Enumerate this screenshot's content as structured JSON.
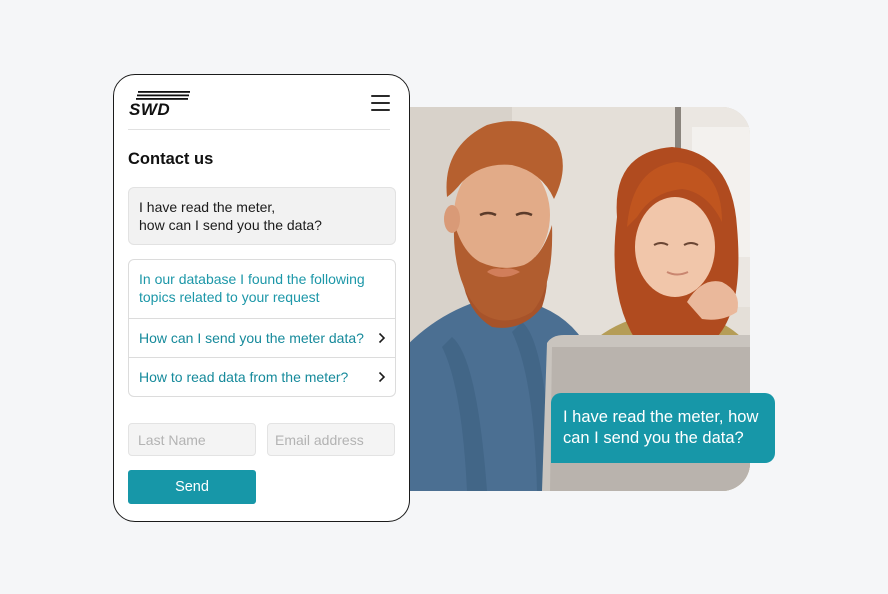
{
  "brand": {
    "logo_text": "SWD",
    "accent": "#1797a8"
  },
  "header": {
    "menu_icon": "hamburger-menu-icon"
  },
  "contact": {
    "title": "Contact us",
    "user_message_line1": "I have read the meter,",
    "user_message_line2": "how can I send you the data?",
    "suggestions_intro_line1": "In our database I found the following",
    "suggestions_intro_line2": "topics related to your request",
    "suggestions": [
      {
        "label": "How can I send you the meter data?",
        "icon": "chevron-right-icon"
      },
      {
        "label": "How to read data from the meter?",
        "icon": "chevron-right-icon"
      }
    ]
  },
  "form": {
    "last_name_placeholder": "Last Name",
    "email_placeholder": "Email address",
    "send_label": "Send"
  },
  "bubble": {
    "line1": "I have read the meter, how",
    "line2": "can I send you the data?"
  }
}
